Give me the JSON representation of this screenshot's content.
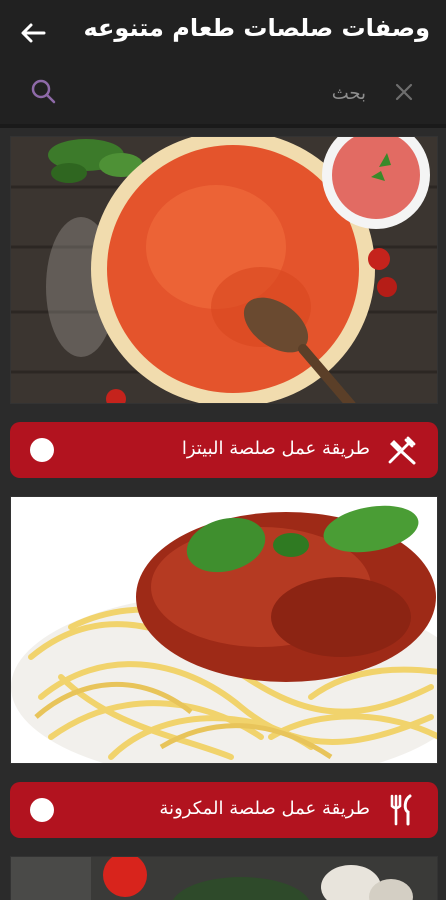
{
  "appbar": {
    "title": "وصفات صلصات طعام متنوعه",
    "back_icon": "arrow-left-icon"
  },
  "search": {
    "placeholder": "بحث",
    "search_icon": "search-icon",
    "clear_icon": "close-icon"
  },
  "recipes": [
    {
      "label": "طريقة عمل صلصة البيتزا",
      "icon": "fork-knife-icon",
      "image": "pizza-sauce-photo"
    },
    {
      "label": "طريقة عمل صلصة المكرونة",
      "icon": "fork-knife-icon",
      "image": "pasta-sauce-photo"
    }
  ],
  "colors": {
    "appbar_bg": "#212121",
    "page_bg": "#2b2b2b",
    "card_accent": "#b2131f",
    "search_icon": "#8e6aa8"
  }
}
